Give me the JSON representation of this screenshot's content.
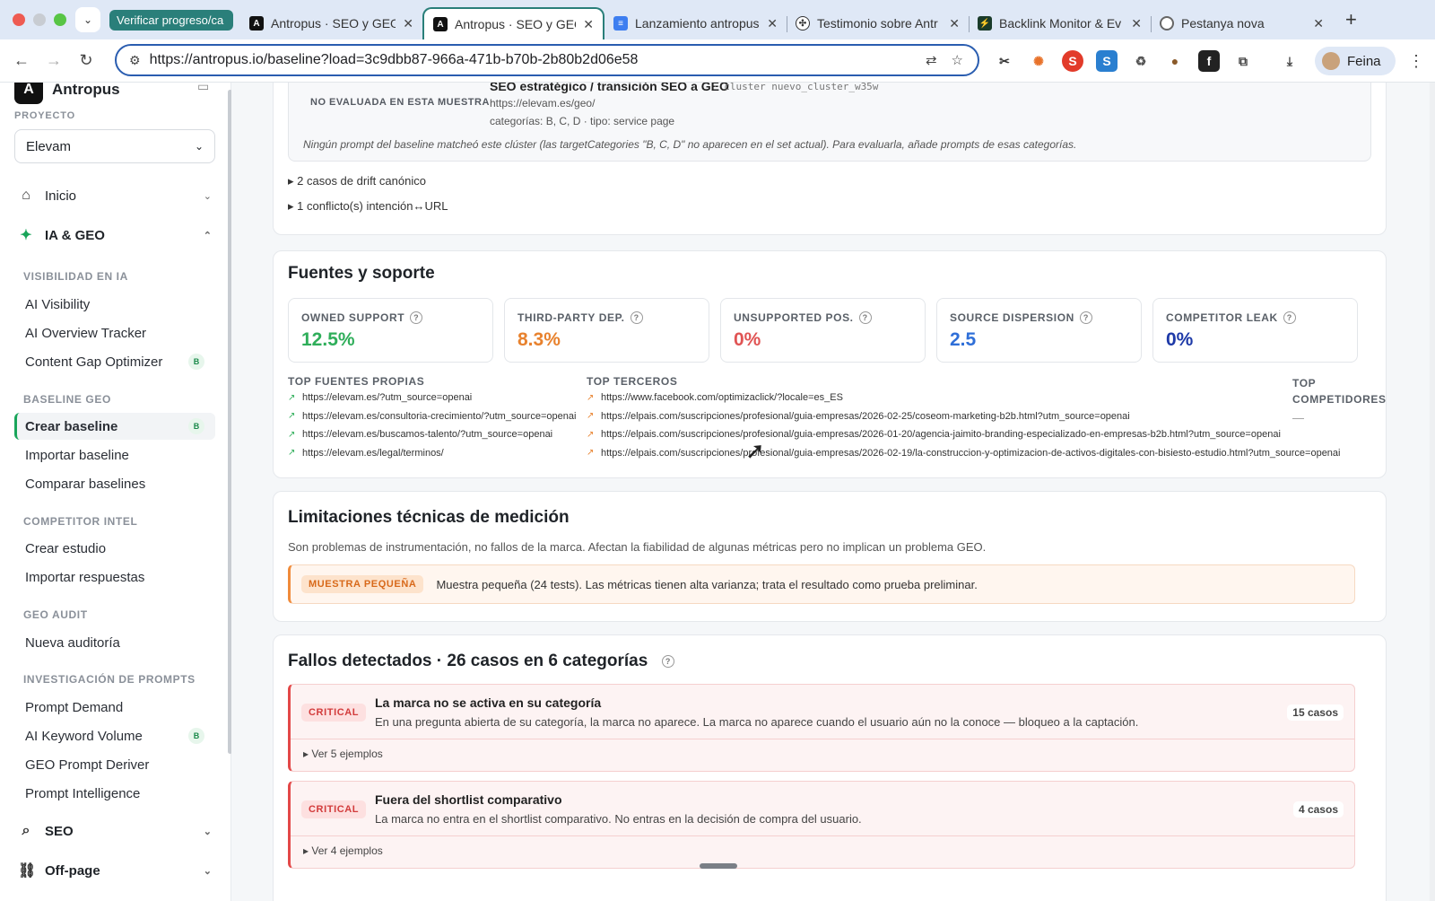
{
  "browser": {
    "tab_group": "Verificar progreso/ca",
    "tabs": [
      {
        "title": "Antropus · SEO y GEO",
        "icon": "antropus-icon",
        "active": false
      },
      {
        "title": "Antropus · SEO y GEO",
        "icon": "antropus-icon",
        "active": true
      },
      {
        "title": "Lanzamiento antropus",
        "icon": "docs-icon",
        "active": false
      },
      {
        "title": "Testimonio sobre Antr",
        "icon": "chatgpt-icon",
        "active": false
      },
      {
        "title": "Backlink Monitor & Ev",
        "icon": "backlink-icon",
        "active": false
      },
      {
        "title": "Pestanya nova",
        "icon": "chrome-icon",
        "active": false
      }
    ],
    "url": "https://antropus.io/baseline?load=3c9dbb87-966a-471b-b70b-2b80b2d06e58",
    "profile": "Feina"
  },
  "sidebar": {
    "brand": "Antropus",
    "project_label": "PROYECTO",
    "project_value": "Elevam",
    "top": {
      "inicio": "Inicio",
      "ia_geo": "IA & GEO",
      "seo": "SEO",
      "offpage": "Off-page"
    },
    "groups": {
      "visibilidad": "VISIBILIDAD EN IA",
      "baseline": "BASELINE GEO",
      "competitor": "COMPETITOR INTEL",
      "audit": "GEO AUDIT",
      "prompts": "INVESTIGACIÓN DE PROMPTS"
    },
    "items": {
      "ai_visibility": "AI Visibility",
      "ai_overview": "AI Overview Tracker",
      "content_gap": "Content Gap Optimizer",
      "crear_baseline": "Crear baseline",
      "importar_baseline": "Importar baseline",
      "comparar": "Comparar baselines",
      "crear_estudio": "Crear estudio",
      "importar_resp": "Importar respuestas",
      "nueva_auditoria": "Nueva auditoría",
      "prompt_demand": "Prompt Demand",
      "ai_keyword": "AI Keyword Volume",
      "geo_deriver": "GEO Prompt Deriver",
      "prompt_intel": "Prompt Intelligence"
    },
    "badge": "B"
  },
  "cluster": {
    "tag": "NO EVALUADA EN ESTA MUESTRA",
    "title": "SEO estratégico / transición SEO a GEO",
    "cluster_id": "· cluster nuevo_cluster_w35w",
    "url": "https://elevam.es/geo/",
    "cats": "categorías: B, C, D · tipo: service page",
    "note": "Ningún prompt del baseline matcheó este clúster (las targetCategories \"B, C, D\" no aparecen en el set actual). Para evaluarla, añade prompts de esas categorías.",
    "drift": "2 casos de drift canónico",
    "conflict": "1 conflicto(s) intención↔URL"
  },
  "fuentes": {
    "title": "Fuentes y soporte",
    "metrics": [
      {
        "label": "OWNED SUPPORT",
        "value": "12.5%",
        "color": "#2fae5a"
      },
      {
        "label": "THIRD-PARTY DEP.",
        "value": "8.3%",
        "color": "#e8822e"
      },
      {
        "label": "UNSUPPORTED POS.",
        "value": "0%",
        "color": "#e05454"
      },
      {
        "label": "SOURCE DISPERSION",
        "value": "2.5",
        "color": "#2f6fd8"
      },
      {
        "label": "COMPETITOR LEAK",
        "value": "0%",
        "color": "#1e3aa8"
      }
    ],
    "col_propias": "TOP FUENTES PROPIAS",
    "col_terceros": "TOP TERCEROS",
    "col_comp": "TOP COMPETIDORES",
    "comp_empty": "—",
    "propias": [
      "https://elevam.es/?utm_source=openai",
      "https://elevam.es/consultoria-crecimiento/?utm_source=openai",
      "https://elevam.es/buscamos-talento/?utm_source=openai",
      "https://elevam.es/legal/terminos/"
    ],
    "terceros": [
      "https://www.facebook.com/optimizaclick/?locale=es_ES",
      "https://elpais.com/suscripciones/profesional/guia-empresas/2026-02-25/coseom-marketing-b2b.html?utm_source=openai",
      "https://elpais.com/suscripciones/profesional/guia-empresas/2026-01-20/agencia-jaimito-branding-especializado-en-empresas-b2b.html?utm_source=openai",
      "https://elpais.com/suscripciones/profesional/guia-empresas/2026-02-19/la-construccion-y-optimizacion-de-activos-digitales-con-bisiesto-estudio.html?utm_source=openai"
    ]
  },
  "limitaciones": {
    "title": "Limitaciones técnicas de medición",
    "desc": "Son problemas de instrumentación, no fallos de la marca. Afectan la fiabilidad de algunas métricas pero no implican un problema GEO.",
    "tag": "MUESTRA PEQUEÑA",
    "text": "Muestra pequeña (24 tests). Las métricas tienen alta varianza; trata el resultado como prueba preliminar."
  },
  "fallos": {
    "title": "Fallos detectados · 26 casos en 6 categorías",
    "items": [
      {
        "tag": "CRITICAL",
        "title": "La marca no se activa en su categoría",
        "desc": "En una pregunta abierta de su categoría, la marca no aparece. La marca no aparece cuando el usuario aún no la conoce — bloqueo a la captación.",
        "count": "15 casos",
        "examples": "Ver 5 ejemplos"
      },
      {
        "tag": "CRITICAL",
        "title": "Fuera del shortlist comparativo",
        "desc": "La marca no entra en el shortlist comparativo. No entras en la decisión de compra del usuario.",
        "count": "4 casos",
        "examples": "Ver 4 ejemplos"
      }
    ]
  }
}
